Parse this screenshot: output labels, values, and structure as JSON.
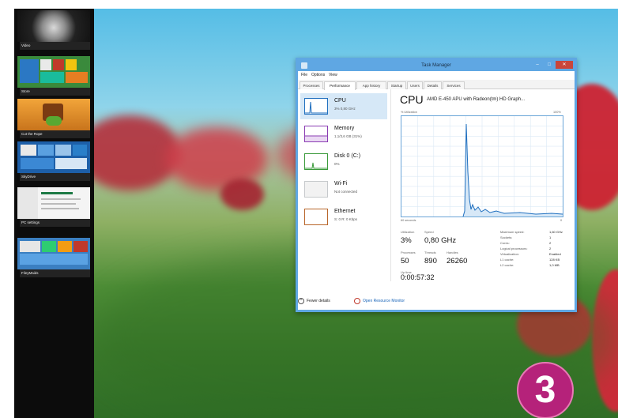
{
  "switcher": {
    "items": [
      {
        "label": "Video"
      },
      {
        "label": "Store"
      },
      {
        "label": "Cut the Rope"
      },
      {
        "label": "SkyDrive"
      },
      {
        "label": "PC settings"
      },
      {
        "label": "FileyMaids"
      }
    ]
  },
  "task_manager": {
    "title": "Task Manager",
    "window_buttons": [
      "–",
      "□",
      "✕"
    ],
    "menu": [
      "File",
      "Options",
      "View"
    ],
    "tabs": [
      "Processes",
      "Performance",
      "App history",
      "Startup",
      "Users",
      "Details",
      "Services"
    ],
    "active_tab": "Performance",
    "resources": [
      {
        "name": "CPU",
        "detail": "3%  0,80 GHz",
        "color": "#1f6fbf",
        "icon": "cpu-graph-icon"
      },
      {
        "name": "Memory",
        "detail": "1,1/3,6 GB (31%)",
        "color": "#8a3cb3",
        "icon": "memory-graph-icon"
      },
      {
        "name": "Disk 0 (C:)",
        "detail": "0%",
        "color": "#3a9a3a",
        "icon": "disk-graph-icon"
      },
      {
        "name": "Wi-Fi",
        "detail": "Not connected",
        "color": "#9aa0a6",
        "icon": "wifi-graph-icon"
      },
      {
        "name": "Ethernet",
        "detail": "S: 0 R: 0 Kbps",
        "color": "#b8652a",
        "icon": "ethernet-graph-icon"
      }
    ],
    "detail": {
      "heading": "CPU",
      "model": "AMD E-450 APU with Radeon(tm) HD Graph...",
      "graph_label_top_left": "% Utilization",
      "graph_label_top_right": "100%",
      "graph_label_bottom_left": "60 seconds",
      "graph_label_bottom_right": "0",
      "stats": {
        "utilization_label": "Utilization",
        "utilization": "3%",
        "speed_label": "Speed",
        "speed": "0,80 GHz",
        "processes_label": "Processes",
        "processes": "50",
        "threads_label": "Threads",
        "threads": "890",
        "handles_label": "Handles",
        "handles": "26260",
        "uptime_label": "Up time",
        "uptime": "0:00:57:32"
      },
      "specs": [
        {
          "key": "Maximum speed:",
          "value": "1,60 GHz"
        },
        {
          "key": "Sockets:",
          "value": "1"
        },
        {
          "key": "Cores:",
          "value": "2"
        },
        {
          "key": "Logical processors:",
          "value": "2"
        },
        {
          "key": "Virtualization:",
          "value": "Enabled"
        },
        {
          "key": "L1 cache:",
          "value": "128 KB"
        },
        {
          "key": "L2 cache:",
          "value": "1,0 MB"
        }
      ]
    },
    "footer": {
      "fewer_details": "Fewer details",
      "open_resource_monitor": "Open Resource Monitor"
    }
  },
  "badge": {
    "number": "3",
    "color": "#b5227a"
  }
}
